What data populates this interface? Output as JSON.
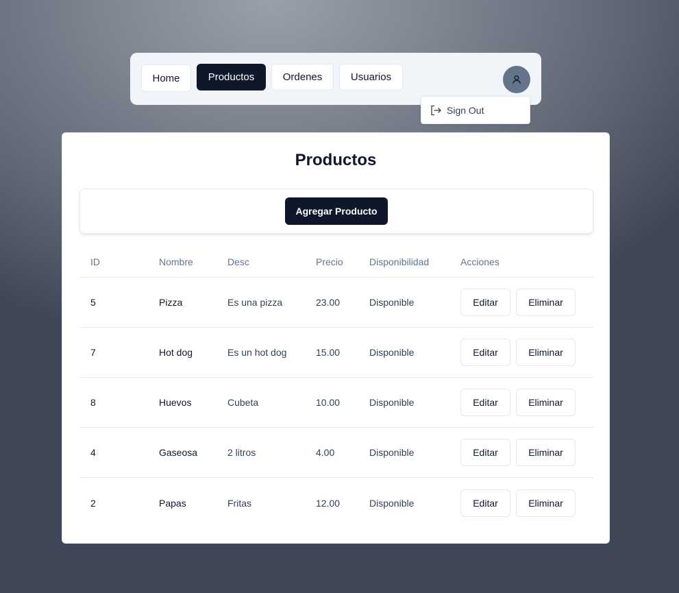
{
  "nav": {
    "items": [
      {
        "label": "Home",
        "active": false
      },
      {
        "label": "Productos",
        "active": true
      },
      {
        "label": "Ordenes",
        "active": false
      },
      {
        "label": "Usuarios",
        "active": false
      }
    ],
    "avatar_icon": "user-icon"
  },
  "user_menu": {
    "sign_out_label": "Sign Out",
    "sign_out_icon": "log-out-icon"
  },
  "page": {
    "title": "Productos",
    "add_button_label": "Agregar Producto"
  },
  "table": {
    "headers": [
      "ID",
      "Nombre",
      "Desc",
      "Precio",
      "Disponibilidad",
      "Acciones"
    ],
    "rows": [
      {
        "id": "5",
        "nombre": "Pizza",
        "desc": "Es una pizza",
        "precio": "23.00",
        "disponibilidad": "Disponible",
        "edit_label": "Editar",
        "delete_label": "Eliminar"
      },
      {
        "id": "7",
        "nombre": "Hot dog",
        "desc": "Es un hot dog",
        "precio": "15.00",
        "disponibilidad": "Disponible",
        "edit_label": "Editar",
        "delete_label": "Eliminar"
      },
      {
        "id": "8",
        "nombre": "Huevos",
        "desc": "Cubeta",
        "precio": "10.00",
        "disponibilidad": "Disponible",
        "edit_label": "Editar",
        "delete_label": "Eliminar"
      },
      {
        "id": "4",
        "nombre": "Gaseosa",
        "desc": "2 litros",
        "precio": "4.00",
        "disponibilidad": "Disponible",
        "edit_label": "Editar",
        "delete_label": "Eliminar"
      },
      {
        "id": "2",
        "nombre": "Papas",
        "desc": "Fritas",
        "precio": "12.00",
        "disponibilidad": "Disponible",
        "edit_label": "Editar",
        "delete_label": "Eliminar"
      }
    ]
  },
  "colors": {
    "primary": "#0f172a",
    "nav_background": "#f1f5f9",
    "avatar": "#64748b",
    "muted_text": "#64748b",
    "border": "#e2e8f0"
  }
}
